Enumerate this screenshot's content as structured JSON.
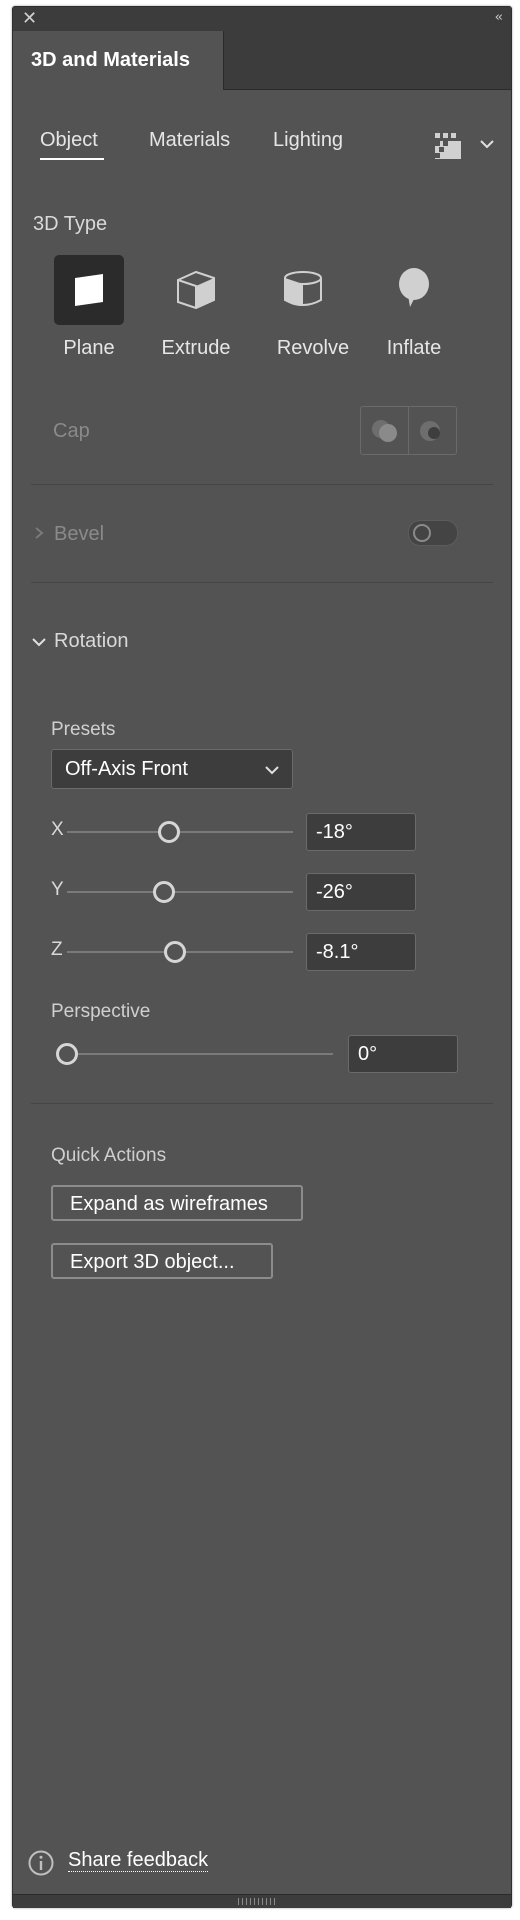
{
  "titlebar": {
    "close_icon": "close-icon",
    "collapse_icon": "collapse-double-chevron-icon"
  },
  "panel": {
    "title": "3D and Materials"
  },
  "subtabs": {
    "items": [
      "Object",
      "Materials",
      "Lighting"
    ],
    "active": "Object"
  },
  "type_section": {
    "heading": "3D Type",
    "items": [
      {
        "label": "Plane",
        "icon": "plane-icon",
        "selected": true
      },
      {
        "label": "Extrude",
        "icon": "extrude-cube-icon",
        "selected": false
      },
      {
        "label": "Revolve",
        "icon": "revolve-cylinder-icon",
        "selected": false
      },
      {
        "label": "Inflate",
        "icon": "inflate-balloon-icon",
        "selected": false
      }
    ]
  },
  "cap": {
    "label": "Cap"
  },
  "bevel": {
    "label": "Bevel",
    "enabled": false
  },
  "rotation": {
    "heading": "Rotation",
    "presets_label": "Presets",
    "preset_value": "Off-Axis Front",
    "x": {
      "label": "X",
      "value": "-18°",
      "position": 0.45
    },
    "y": {
      "label": "Y",
      "value": "-26°",
      "position": 0.43
    },
    "z": {
      "label": "Z",
      "value": "-8.1°",
      "position": 0.48
    },
    "perspective": {
      "label": "Perspective",
      "value": "0°",
      "position": 0.0
    }
  },
  "quick_actions": {
    "heading": "Quick Actions",
    "buttons": [
      "Expand as wireframes",
      "Export 3D object..."
    ]
  },
  "footer": {
    "share_feedback": "Share feedback"
  },
  "colors": {
    "panel_bg": "#535353",
    "dark_bg": "#3c3c3c",
    "field_bg": "#3d3d3d",
    "text": "#ffffff"
  }
}
